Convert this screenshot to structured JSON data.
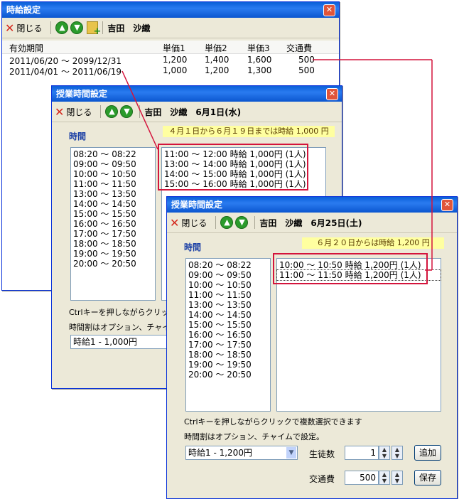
{
  "w1": {
    "title": "時給設定",
    "close": "閉じる",
    "name": "吉田　沙織",
    "headers": [
      "有効期間",
      "単価1",
      "単価2",
      "単価3",
      "交通費"
    ],
    "rows": [
      [
        "2011/06/20 ～ 2099/12/31",
        "1,200",
        "1,400",
        "1,600",
        "500"
      ],
      [
        "2011/04/01 ～ 2011/06/19",
        "1,000",
        "1,200",
        "1,300",
        "500"
      ]
    ]
  },
  "w2": {
    "title": "授業時間設定",
    "close": "閉じる",
    "header": "吉田　沙織　6月1日(水)",
    "note": "４月１日から６月１９日までは時給 1,000 円",
    "section": "時間",
    "times": [
      "08:20 ～ 08:22",
      "09:00 ～ 09:50",
      "10:00 ～ 10:50",
      "11:00 ～ 11:50",
      "13:00 ～ 13:50",
      "14:00 ～ 14:50",
      "15:00 ～ 15:50",
      "16:00 ～ 16:50",
      "17:00 ～ 17:50",
      "18:00 ～ 18:50",
      "19:00 ～ 19:50",
      "20:00 ～ 20:50"
    ],
    "selected": [
      "11:00 ～ 12:00 時給 1,000円 (1人)",
      "13:00 ～ 14:00 時給 1,000円 (1人)",
      "14:00 ～ 15:00 時給 1,000円 (1人)",
      "15:00 ～ 16:00 時給 1,000円 (1人)"
    ],
    "hint1": "Ctrlキーを押しながらクリックで",
    "hint2": "時間割はオプション、チャイムで",
    "select": "時給1 - 1,000円"
  },
  "w3": {
    "title": "授業時間設定",
    "close": "閉じる",
    "header": "吉田　沙織　6月25日(土)",
    "note": "６月２０日からは時給 1,200 円",
    "section": "時間",
    "times": [
      "08:20 ～ 08:22",
      "09:00 ～ 09:50",
      "10:00 ～ 10:50",
      "11:00 ～ 11:50",
      "13:00 ～ 13:50",
      "14:00 ～ 14:50",
      "15:00 ～ 15:50",
      "16:00 ～ 16:50",
      "17:00 ～ 17:50",
      "18:00 ～ 18:50",
      "19:00 ～ 19:50",
      "20:00 ～ 20:50"
    ],
    "selected": [
      "10:00 ～ 10:50 時給 1,200円 (1人)",
      "11:00 ～ 11:50 時給 1,200円 (1人)"
    ],
    "hint1": "Ctrlキーを押しながらクリックで複数選択できます",
    "hint2": "時間割はオプション、チャイムで設定。",
    "select": "時給1 - 1,200円",
    "students_label": "生徒数",
    "students_value": "1",
    "add": "追加",
    "fare_label": "交通費",
    "fare_value": "500",
    "save": "保存"
  }
}
